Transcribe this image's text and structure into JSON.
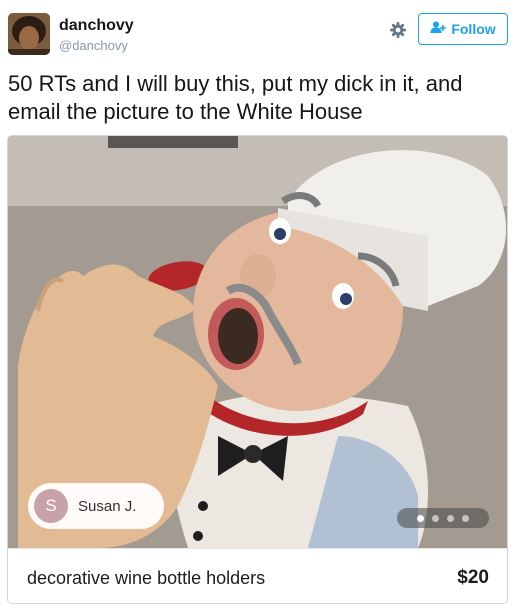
{
  "user": {
    "display_name": "danchovy",
    "handle": "@danchovy"
  },
  "actions": {
    "follow_label": "Follow",
    "settings_icon": "gear-icon",
    "follow_icon": "add-user-icon"
  },
  "tweet": {
    "text": "50 RTs and I will buy this, put my dick in it, and email the picture to the White House"
  },
  "listing": {
    "seller_initial": "S",
    "seller_name": "Susan J.",
    "item_name": "decorative wine bottle holders",
    "price": "$20",
    "carousel": {
      "count": 4,
      "active": 1
    }
  },
  "colors": {
    "accent": "#1da1f2",
    "handle": "#8899a6",
    "seller_avatar": "#c7a2a8"
  }
}
